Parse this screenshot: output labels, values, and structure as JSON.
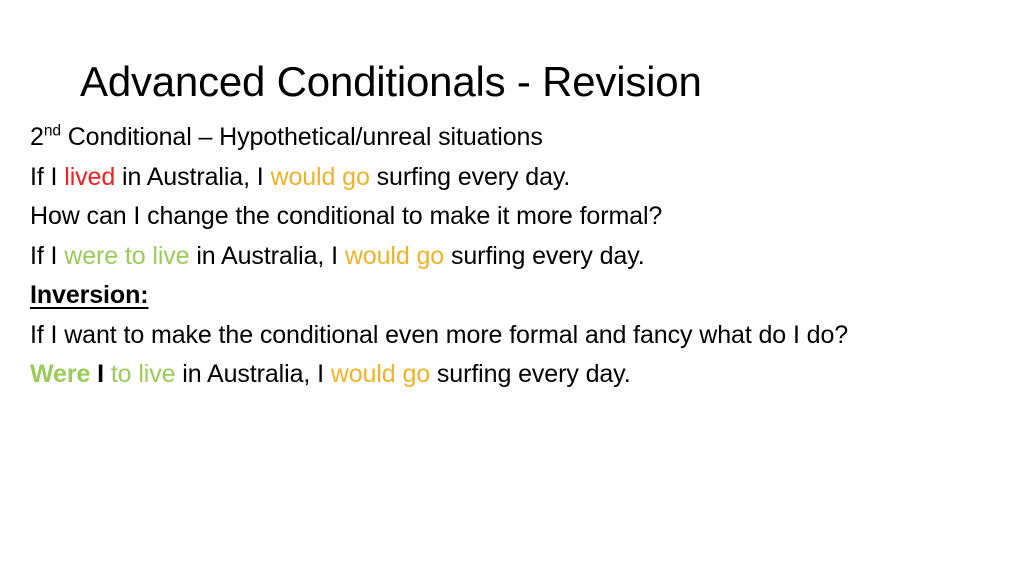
{
  "slide": {
    "background_color": "#ffffff",
    "title": "Advanced Conditionals - Revision",
    "colors": {
      "text": "#000000",
      "red_highlight": "#ee2222",
      "gold_highlight": "#efb32b",
      "green_highlight": "#9ccb5b"
    },
    "lines": [
      {
        "id": "line-second-conditional-heading",
        "plain_text": "2nd Conditional – Hypothetical/unreal situations",
        "runs": [
          {
            "text": "2",
            "color": "black",
            "bold": false,
            "superscript": false
          },
          {
            "text": "nd",
            "color": "black",
            "bold": false,
            "superscript": true
          },
          {
            "text": " Conditional – Hypothetical/unreal situations",
            "color": "black",
            "bold": false,
            "superscript": false
          }
        ]
      },
      {
        "id": "line-example-basic",
        "plain_text": "If I lived in Australia, I would go surfing every day.",
        "runs": [
          {
            "text": "If I ",
            "color": "black",
            "bold": false,
            "superscript": false
          },
          {
            "text": "lived",
            "color": "red",
            "bold": false,
            "superscript": false
          },
          {
            "text": " in Australia, I ",
            "color": "black",
            "bold": false,
            "superscript": false
          },
          {
            "text": "would go",
            "color": "gold",
            "bold": false,
            "superscript": false
          },
          {
            "text": " surfing every day.",
            "color": "black",
            "bold": false,
            "superscript": false
          }
        ]
      },
      {
        "id": "line-question-formal",
        "plain_text": "How can I change the conditional to make it more formal?",
        "runs": [
          {
            "text": "How can I change the conditional to make it more formal?",
            "color": "black",
            "bold": false,
            "superscript": false
          }
        ]
      },
      {
        "id": "line-example-were-to-live",
        "plain_text": "If I were to live in Australia, I would go surfing every day.",
        "runs": [
          {
            "text": "If I ",
            "color": "black",
            "bold": false,
            "superscript": false
          },
          {
            "text": "were to live",
            "color": "green",
            "bold": false,
            "superscript": false
          },
          {
            "text": " in Australia, I ",
            "color": "black",
            "bold": false,
            "superscript": false
          },
          {
            "text": "would go",
            "color": "gold",
            "bold": false,
            "superscript": false
          },
          {
            "text": " surfing every day.",
            "color": "black",
            "bold": false,
            "superscript": false
          }
        ]
      },
      {
        "id": "line-inversion-heading",
        "plain_text": "Inversion:",
        "heading": true,
        "runs": [
          {
            "text": "Inversion:",
            "color": "black",
            "bold": true,
            "underline": true,
            "superscript": false
          }
        ]
      },
      {
        "id": "line-question-fancy",
        "plain_text": "If I want to make the conditional even more formal and fancy what do I do?",
        "runs": [
          {
            "text": "If I want to make the conditional even more formal and fancy what do I do?",
            "color": "black",
            "bold": false,
            "superscript": false
          }
        ]
      },
      {
        "id": "line-example-inverted",
        "plain_text": "Were I to live in Australia, I would go surfing every day.",
        "runs": [
          {
            "text": "Were",
            "color": "green",
            "bold": true,
            "superscript": false
          },
          {
            "text": " I",
            "color": "black",
            "bold": true,
            "superscript": false
          },
          {
            "text": " to live",
            "color": "green",
            "bold": false,
            "superscript": false
          },
          {
            "text": " in Australia, I ",
            "color": "black",
            "bold": false,
            "superscript": false
          },
          {
            "text": "would go",
            "color": "gold",
            "bold": false,
            "superscript": false
          },
          {
            "text": " surfing every day.",
            "color": "black",
            "bold": false,
            "superscript": false
          }
        ]
      }
    ]
  }
}
